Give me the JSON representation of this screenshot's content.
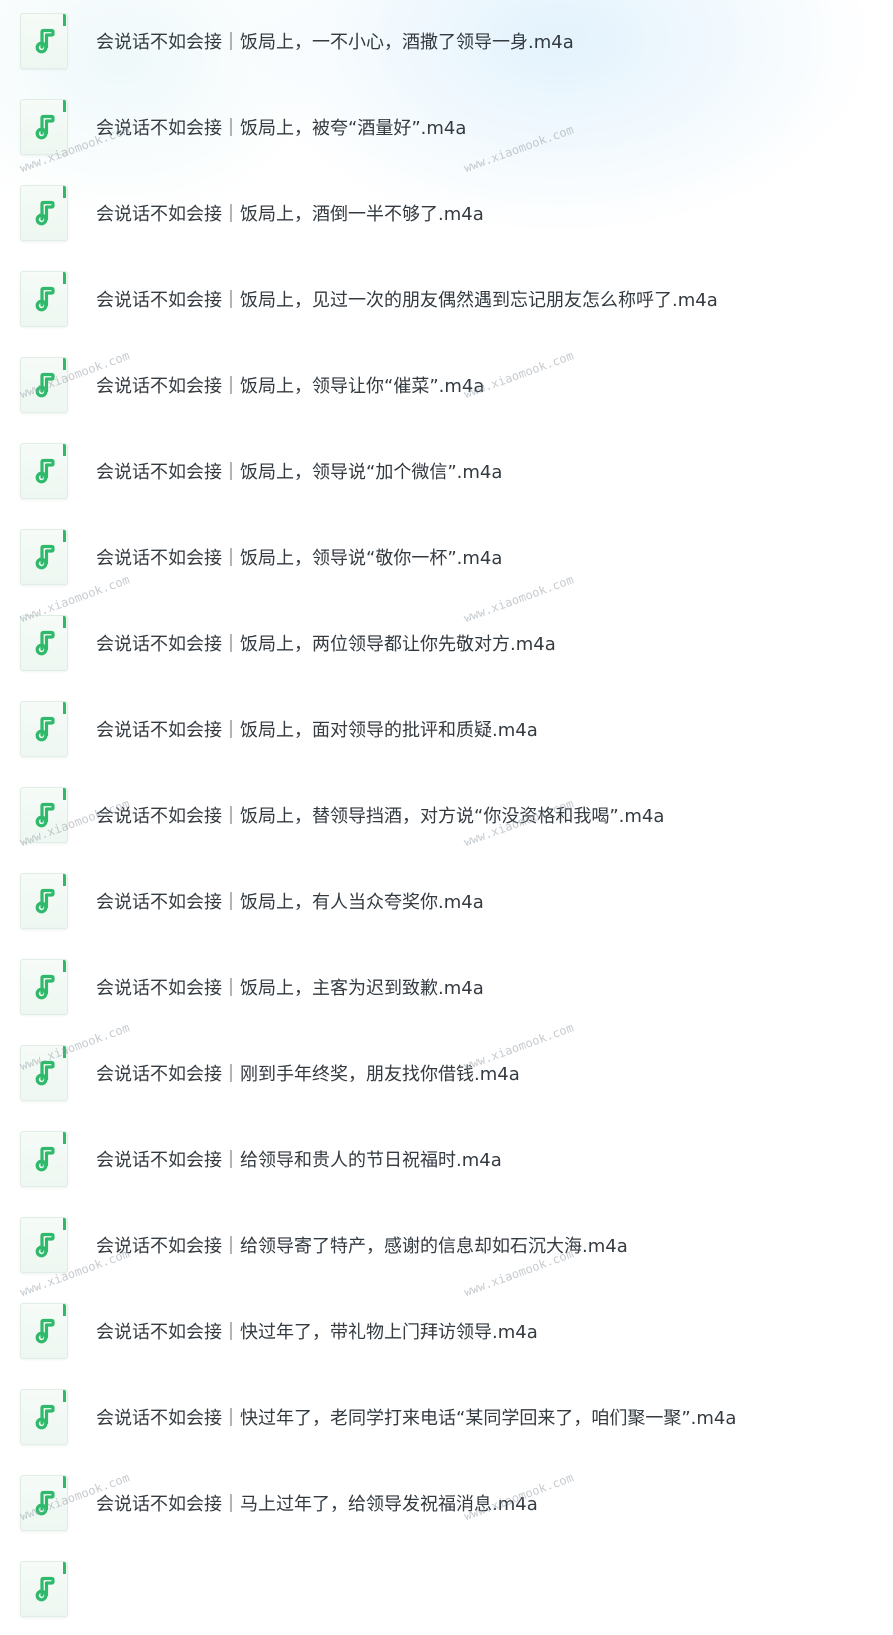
{
  "icon": "music-note-icon",
  "accent_color": "#2fb96a",
  "watermark_text": "www.xiaomook.com",
  "files": [
    {
      "name": "会说话不如会接｜饭局上，一不小心，酒撒了领导一身.m4a"
    },
    {
      "name": "会说话不如会接｜饭局上，被夸“酒量好”.m4a"
    },
    {
      "name": "会说话不如会接｜饭局上，酒倒一半不够了.m4a"
    },
    {
      "name": "会说话不如会接｜饭局上，见过一次的朋友偶然遇到忘记朋友怎么称呼了.m4a"
    },
    {
      "name": "会说话不如会接｜饭局上，领导让你“催菜”.m4a"
    },
    {
      "name": "会说话不如会接｜饭局上，领导说“加个微信”.m4a"
    },
    {
      "name": "会说话不如会接｜饭局上，领导说“敬你一杯”.m4a"
    },
    {
      "name": "会说话不如会接｜饭局上，两位领导都让你先敬对方.m4a"
    },
    {
      "name": "会说话不如会接｜饭局上，面对领导的批评和质疑.m4a"
    },
    {
      "name": "会说话不如会接｜饭局上，替领导挡酒，对方说“你没资格和我喝”.m4a"
    },
    {
      "name": "会说话不如会接｜饭局上，有人当众夸奖你.m4a"
    },
    {
      "name": "会说话不如会接｜饭局上，主客为迟到致歉.m4a"
    },
    {
      "name": "会说话不如会接｜刚到手年终奖，朋友找你借钱.m4a"
    },
    {
      "name": "会说话不如会接｜给领导和贵人的节日祝福时.m4a"
    },
    {
      "name": "会说话不如会接｜给领导寄了特产，感谢的信息却如石沉大海.m4a"
    },
    {
      "name": "会说话不如会接｜快过年了，带礼物上门拜访领导.m4a"
    },
    {
      "name": "会说话不如会接｜快过年了，老同学打来电话“某同学回来了，咱们聚一聚”.m4a"
    },
    {
      "name": "会说话不如会接｜马上过年了，给领导发祝福消息.m4a"
    },
    {
      "name": ""
    }
  ]
}
